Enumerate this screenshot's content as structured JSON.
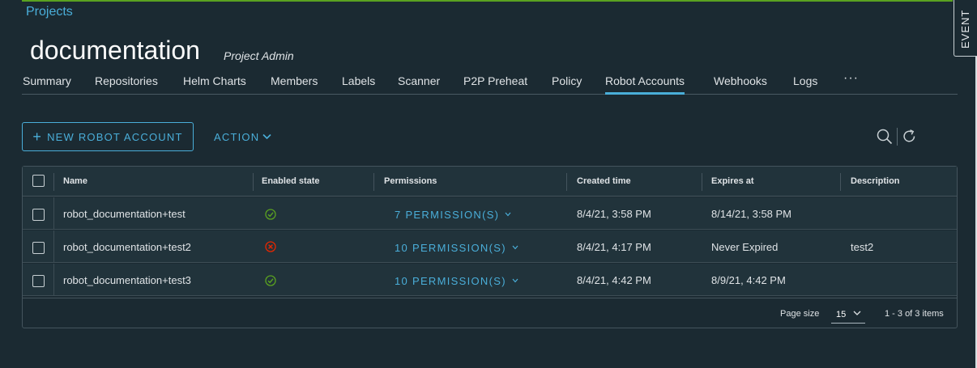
{
  "breadcrumb": "Projects",
  "project": {
    "name": "documentation",
    "role": "Project Admin"
  },
  "tabs": [
    {
      "label": "Summary"
    },
    {
      "label": "Repositories"
    },
    {
      "label": "Helm Charts"
    },
    {
      "label": "Members"
    },
    {
      "label": "Labels"
    },
    {
      "label": "Scanner"
    },
    {
      "label": "P2P Preheat"
    },
    {
      "label": "Policy"
    },
    {
      "label": "Robot Accounts",
      "active": true
    },
    {
      "label": "Webhooks"
    },
    {
      "label": "Logs"
    }
  ],
  "tabs_more": "···",
  "event_panel": "EVENT",
  "toolbar": {
    "new_label": "NEW ROBOT ACCOUNT",
    "action_label": "ACTION"
  },
  "table": {
    "headers": [
      "Name",
      "Enabled state",
      "Permissions",
      "Created time",
      "Expires at",
      "Description"
    ],
    "rows": [
      {
        "name": "robot_documentation+test",
        "enabled": true,
        "permissions": "7 PERMISSION(S)",
        "created": "8/4/21, 3:58 PM",
        "expires": "8/14/21, 3:58 PM",
        "description": ""
      },
      {
        "name": "robot_documentation+test2",
        "enabled": false,
        "permissions": "10 PERMISSION(S)",
        "created": "8/4/21, 4:17 PM",
        "expires": "Never Expired",
        "description": "test2"
      },
      {
        "name": "robot_documentation+test3",
        "enabled": true,
        "permissions": "10 PERMISSION(S)",
        "created": "8/4/21, 4:42 PM",
        "expires": "8/9/21, 4:42 PM",
        "description": ""
      }
    ]
  },
  "footer": {
    "page_size_label": "Page size",
    "page_size": "15",
    "range": "1 - 3 of 3 items"
  },
  "colors": {
    "accent": "#4aaed9",
    "enabled": "#5aa220",
    "disabled": "#e62700",
    "background": "#1b2a32"
  }
}
